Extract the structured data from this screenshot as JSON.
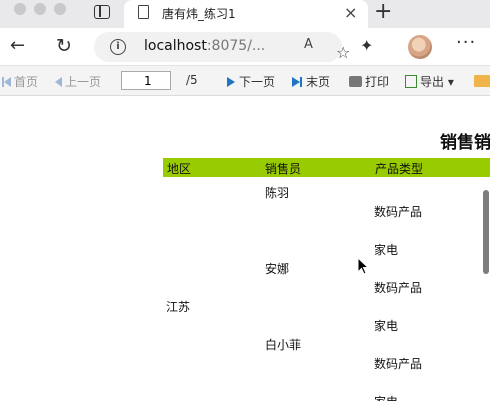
{
  "browser": {
    "tab_title": "唐有炜_练习1",
    "tab_close": "×",
    "new_tab": "+",
    "url_host": "localhost",
    "url_rest": ":8075/...",
    "read_aloud": "A",
    "more": "···"
  },
  "toolbar": {
    "first_page": "首页",
    "prev_page": "上一页",
    "page_value": "1",
    "page_total": "/5",
    "next_page": "下一页",
    "last_page": "末页",
    "print": "打印",
    "export": "导出"
  },
  "report": {
    "title": "销售销",
    "columns": [
      "地区",
      "销售员",
      "产品类型"
    ],
    "region": "江苏",
    "salespeople": [
      "陈羽",
      "安娜",
      "白小菲"
    ],
    "product_types": [
      "数码产品",
      "家电",
      "数码产品",
      "家电",
      "数码产品",
      "家电"
    ]
  },
  "colors": {
    "header_bg": "#99cc00",
    "nav_accent": "#1e74c5"
  }
}
